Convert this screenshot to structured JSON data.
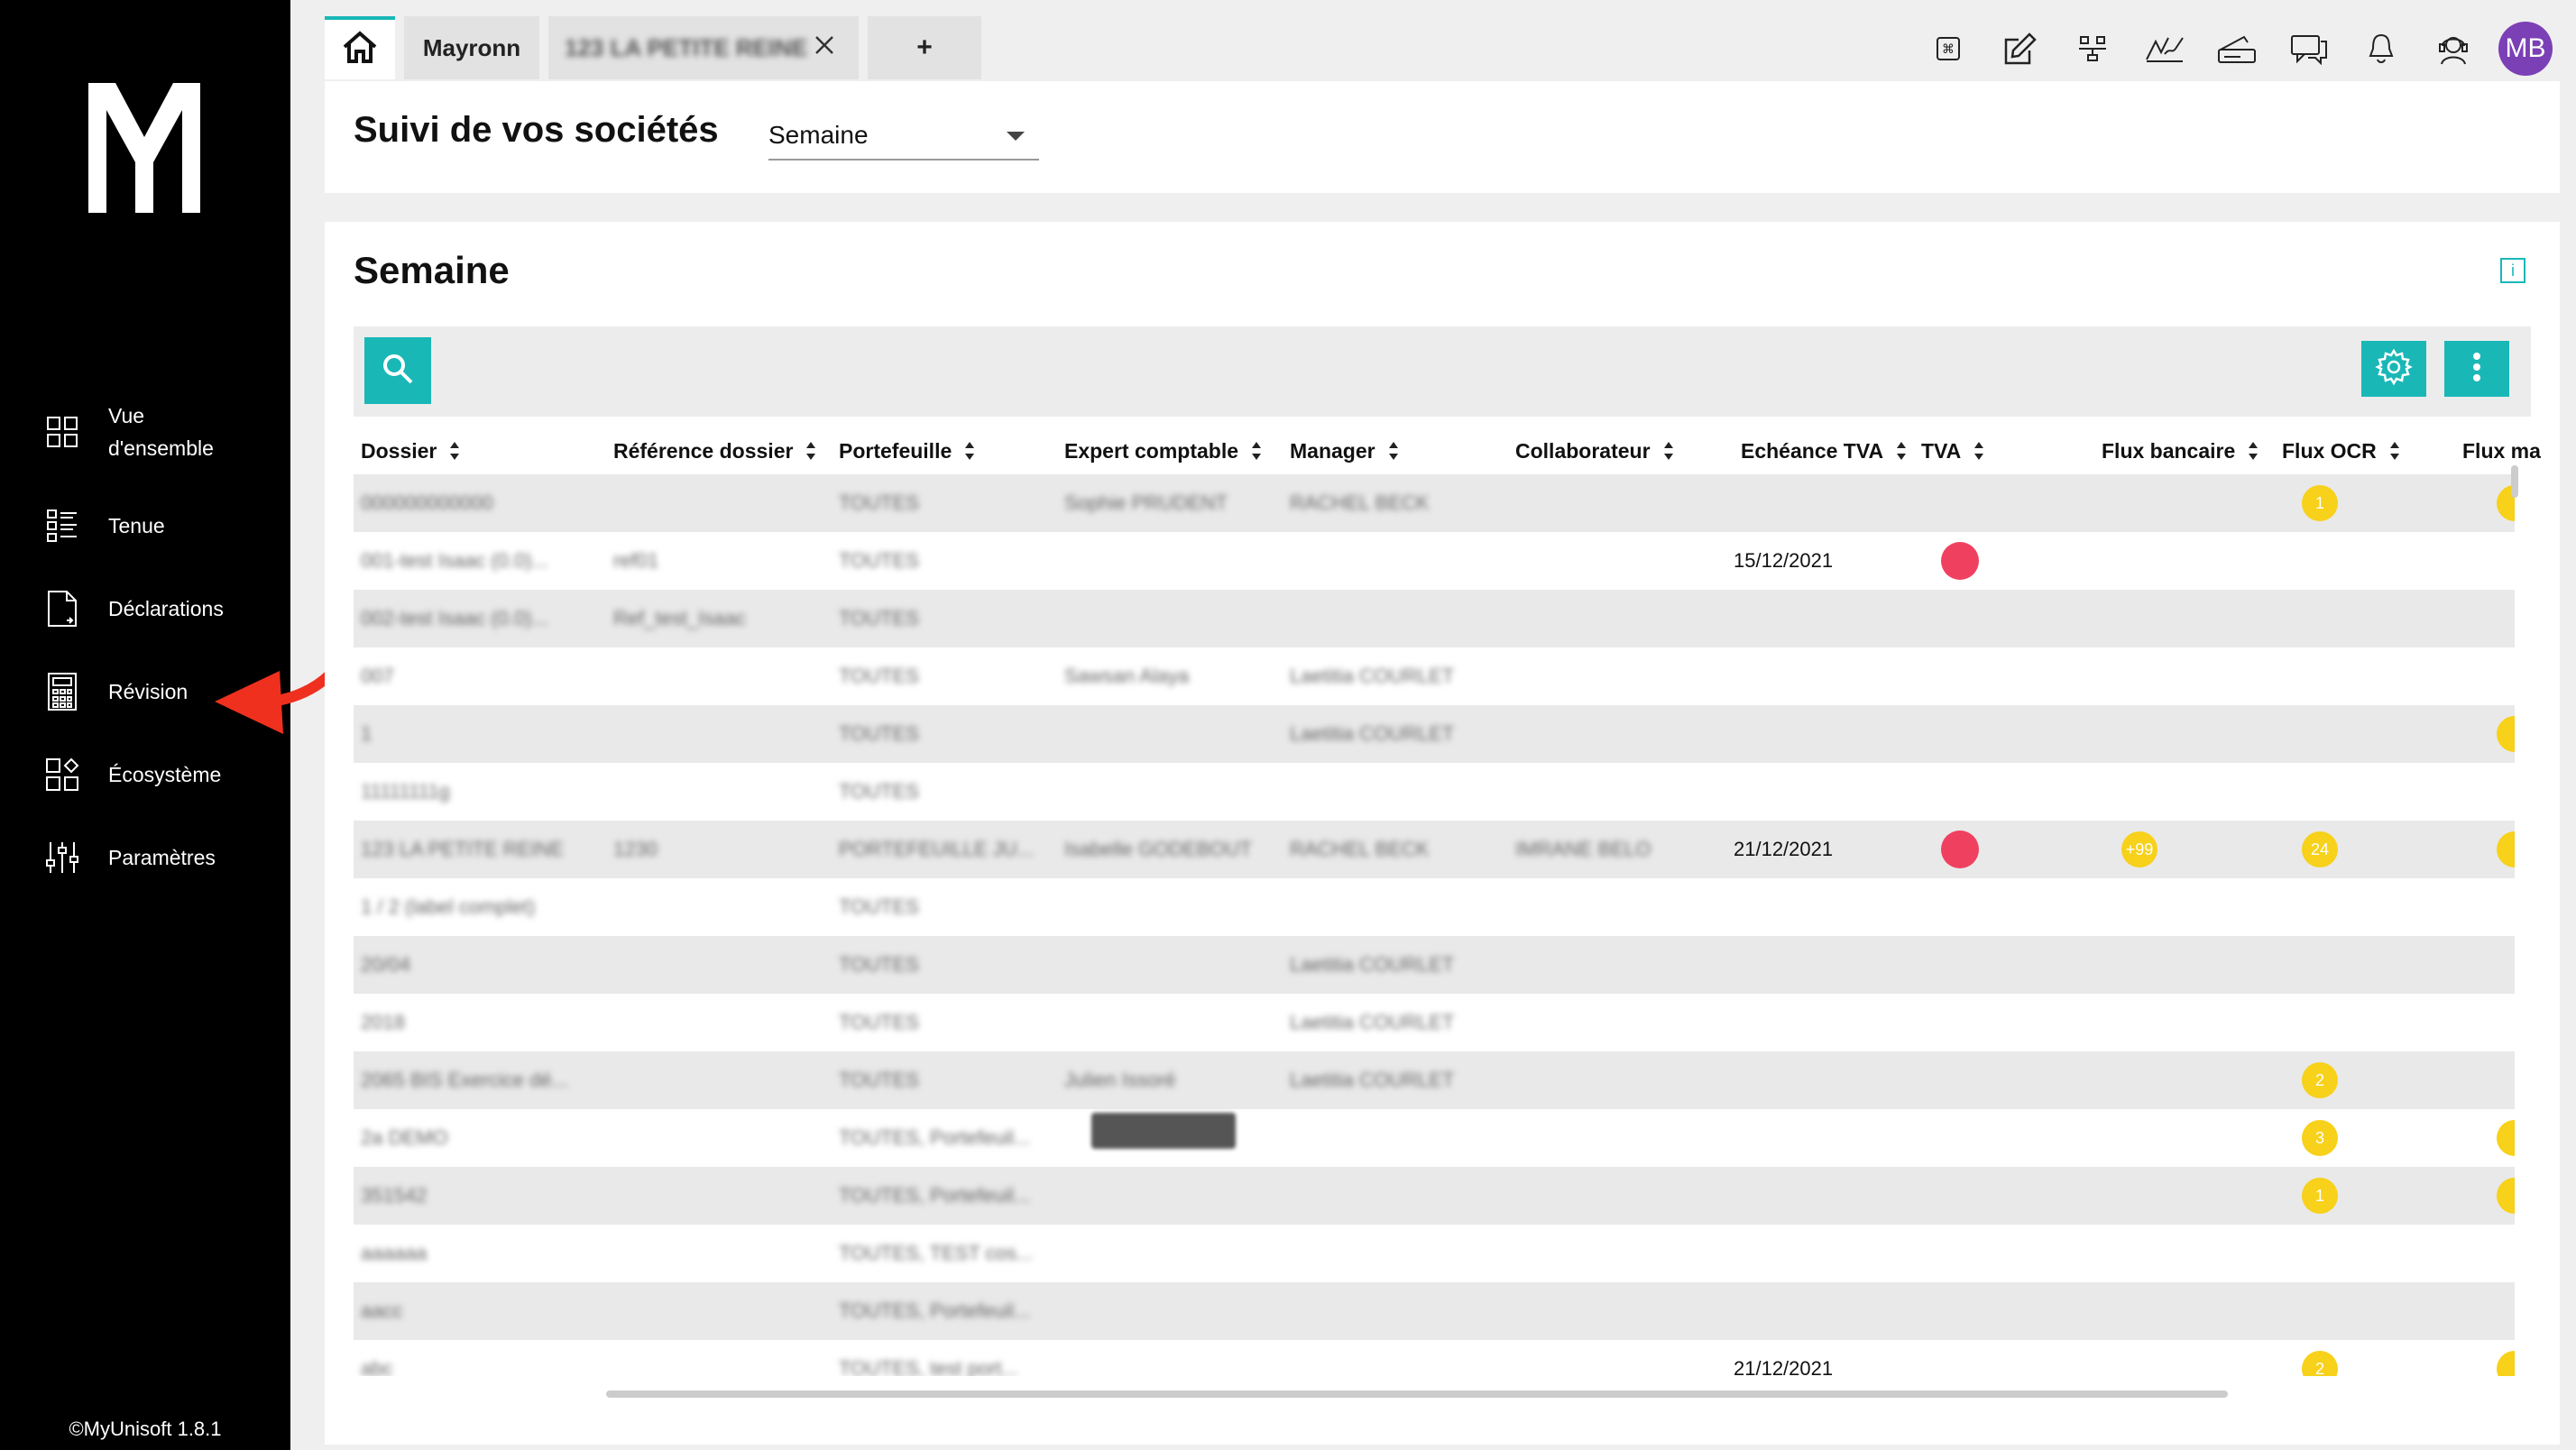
{
  "sidebar": {
    "items": [
      {
        "label": "Vue d'ensemble",
        "icon": "grid-icon"
      },
      {
        "label": "Tenue",
        "icon": "list-icon"
      },
      {
        "label": "Déclarations",
        "icon": "document-icon"
      },
      {
        "label": "Révision",
        "icon": "calculator-icon"
      },
      {
        "label": "Écosystème",
        "icon": "apps-icon"
      },
      {
        "label": "Paramètres",
        "icon": "sliders-icon"
      }
    ],
    "copyright": "©MyUnisoft 1.8.1"
  },
  "tabs": {
    "home_icon": "home-icon",
    "tab1": "Mayronn",
    "tab2": "123 LA PETITE REINE",
    "add": "+"
  },
  "topbar": {
    "icons": [
      "command-icon",
      "edit-icon",
      "network-icon",
      "signature-icon",
      "scanner-icon",
      "chat-icon",
      "bell-icon",
      "support-icon"
    ],
    "avatar": "MB"
  },
  "header": {
    "title": "Suivi de vos sociétés",
    "period_select": "Semaine"
  },
  "main": {
    "title": "Semaine",
    "columns": [
      "Dossier",
      "Référence dossier",
      "Portefeuille",
      "Expert comptable",
      "Manager",
      "Collaborateur",
      "Echéance TVA",
      "TVA",
      "Flux bancaire",
      "Flux OCR",
      "Flux ma"
    ],
    "rows": [
      {
        "dossier": "000000000000",
        "ref": "",
        "portefeuille": "TOUTES",
        "expert": "Sophie PRUDENT",
        "manager": "RACHEL BECK",
        "collab": "",
        "echeance": "",
        "tva": false,
        "flux_bancaire": "",
        "flux_ocr": "1",
        "flux_ma": true
      },
      {
        "dossier": "001-test Isaac (0.0)...",
        "ref": "ref01",
        "portefeuille": "TOUTES",
        "expert": "",
        "manager": "",
        "collab": "",
        "echeance": "15/12/2021",
        "tva": true,
        "flux_bancaire": "",
        "flux_ocr": "",
        "flux_ma": false
      },
      {
        "dossier": "002-test Isaac (0.0)...",
        "ref": "Ref_test_Isaac",
        "portefeuille": "TOUTES",
        "expert": "",
        "manager": "",
        "collab": "",
        "echeance": "",
        "tva": false,
        "flux_bancaire": "",
        "flux_ocr": "",
        "flux_ma": false
      },
      {
        "dossier": "007",
        "ref": "",
        "portefeuille": "TOUTES",
        "expert": "Sawsan Alaya",
        "manager": "Laetitia COURLET",
        "collab": "",
        "echeance": "",
        "tva": false,
        "flux_bancaire": "",
        "flux_ocr": "",
        "flux_ma": false
      },
      {
        "dossier": "1",
        "ref": "",
        "portefeuille": "TOUTES",
        "expert": "",
        "manager": "Laetitia COURLET",
        "collab": "",
        "echeance": "",
        "tva": false,
        "flux_bancaire": "",
        "flux_ocr": "",
        "flux_ma": true
      },
      {
        "dossier": "11111111g",
        "ref": "",
        "portefeuille": "TOUTES",
        "expert": "",
        "manager": "",
        "collab": "",
        "echeance": "",
        "tva": false,
        "flux_bancaire": "",
        "flux_ocr": "",
        "flux_ma": false
      },
      {
        "dossier": "123 LA PETITE REINE",
        "ref": "1230",
        "portefeuille": "PORTEFEUILLE JU...",
        "expert": "Isabelle GODEBOUT",
        "manager": "RACHEL BECK",
        "collab": "IMRANE BELO",
        "echeance": "21/12/2021",
        "tva": true,
        "flux_bancaire": "+99",
        "flux_ocr": "24",
        "flux_ma": true
      },
      {
        "dossier": "1 / 2 (label complet)",
        "ref": "",
        "portefeuille": "TOUTES",
        "expert": "",
        "manager": "",
        "collab": "",
        "echeance": "",
        "tva": false,
        "flux_bancaire": "",
        "flux_ocr": "",
        "flux_ma": false
      },
      {
        "dossier": "20/04",
        "ref": "",
        "portefeuille": "TOUTES",
        "expert": "",
        "manager": "Laetitia COURLET",
        "collab": "",
        "echeance": "",
        "tva": false,
        "flux_bancaire": "",
        "flux_ocr": "",
        "flux_ma": false
      },
      {
        "dossier": "2018",
        "ref": "",
        "portefeuille": "TOUTES",
        "expert": "",
        "manager": "Laetitia COURLET",
        "collab": "",
        "echeance": "",
        "tva": false,
        "flux_bancaire": "",
        "flux_ocr": "",
        "flux_ma": false
      },
      {
        "dossier": "2065 BIS Exercice dé...",
        "ref": "",
        "portefeuille": "TOUTES",
        "expert": "Julien Issoré",
        "manager": "Laetitia COURLET",
        "collab": "",
        "echeance": "",
        "tva": false,
        "flux_bancaire": "",
        "flux_ocr": "2",
        "flux_ma": false
      },
      {
        "dossier": "2a DEMO",
        "ref": "",
        "portefeuille": "TOUTES, Portefeuil...",
        "expert": "",
        "manager": "",
        "collab": "",
        "echeance": "",
        "tva": false,
        "flux_bancaire": "",
        "flux_ocr": "3",
        "flux_ma": true
      },
      {
        "dossier": "351542",
        "ref": "",
        "portefeuille": "TOUTES, Portefeuil...",
        "expert": "",
        "manager": "",
        "collab": "",
        "echeance": "",
        "tva": false,
        "flux_bancaire": "",
        "flux_ocr": "1",
        "flux_ma": true
      },
      {
        "dossier": "aaaaaa",
        "ref": "",
        "portefeuille": "TOUTES, TEST cos...",
        "expert": "",
        "manager": "",
        "collab": "",
        "echeance": "",
        "tva": false,
        "flux_bancaire": "",
        "flux_ocr": "",
        "flux_ma": false
      },
      {
        "dossier": "aacc",
        "ref": "",
        "portefeuille": "TOUTES, Portefeuil...",
        "expert": "",
        "manager": "",
        "collab": "",
        "echeance": "",
        "tva": false,
        "flux_bancaire": "",
        "flux_ocr": "",
        "flux_ma": false
      },
      {
        "dossier": "abc",
        "ref": "",
        "portefeuille": "TOUTES, test port...",
        "expert": "",
        "manager": "",
        "collab": "",
        "echeance": "21/12/2021",
        "tva": false,
        "flux_bancaire": "",
        "flux_ocr": "2",
        "flux_ma": true
      }
    ]
  },
  "colors": {
    "accent": "#1ab7b7",
    "sidebar": "#000000",
    "tva_dot": "#f04060",
    "flux_dot": "#f7d11a",
    "avatar": "#7b3fb6",
    "annotation_arrow": "#f0301e"
  }
}
